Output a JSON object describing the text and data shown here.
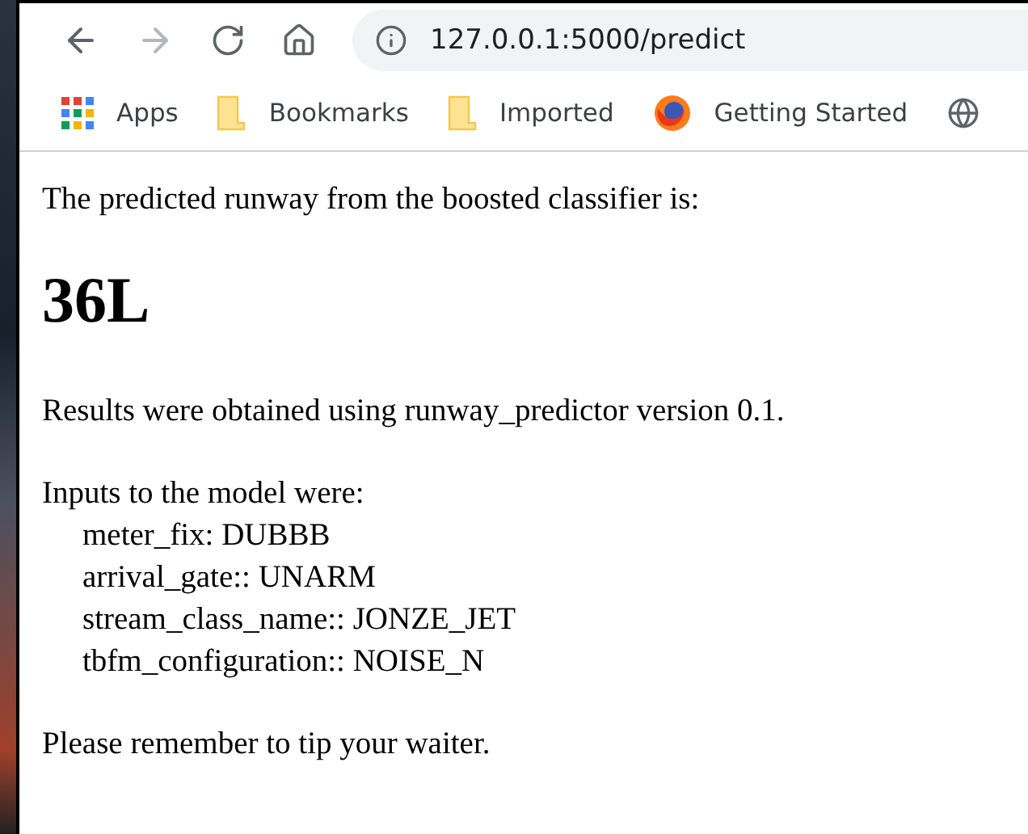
{
  "toolbar": {
    "url": "127.0.0.1:5000/predict",
    "forward_disabled": true
  },
  "bookmarks": [
    {
      "kind": "apps",
      "label": "Apps"
    },
    {
      "kind": "folder",
      "label": "Bookmarks"
    },
    {
      "kind": "folder",
      "label": "Imported"
    },
    {
      "kind": "browser",
      "label": "Getting Started"
    },
    {
      "kind": "globe"
    }
  ],
  "page": {
    "intro": "The predicted runway from the boosted classifier is:",
    "result": "36L",
    "version_note": "Results were obtained using runway_predictor version 0.1.",
    "inputs_heading": "Inputs to the model were:",
    "inputs": [
      "meter_fix: DUBBB",
      "arrival_gate:: UNARM",
      "stream_class_name:: JONZE_JET",
      "tbfm_configuration:: NOISE_N"
    ],
    "closing": "Please remember to tip your waiter."
  }
}
